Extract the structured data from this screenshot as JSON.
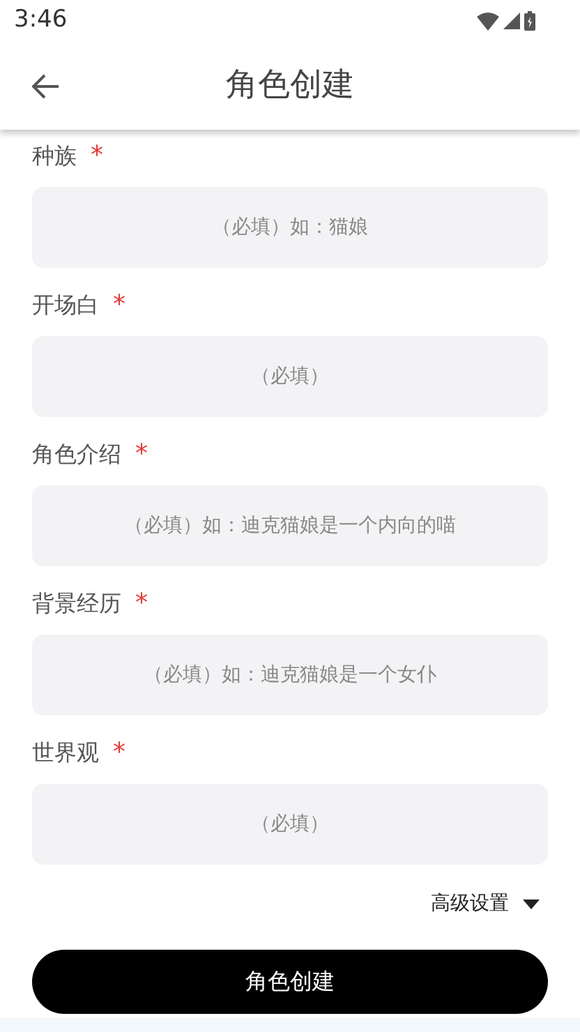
{
  "status_bar": {
    "time": "3:46"
  },
  "header": {
    "title": "角色创建"
  },
  "fields": [
    {
      "label": "种族",
      "required_mark": "*",
      "placeholder": "（必填）如：猫娘"
    },
    {
      "label": "开场白",
      "required_mark": "*",
      "placeholder": "（必填）"
    },
    {
      "label": "角色介绍",
      "required_mark": "*",
      "placeholder": "（必填）如：迪克猫娘是一个内向的喵"
    },
    {
      "label": "背景经历",
      "required_mark": "*",
      "placeholder": "（必填）如：迪克猫娘是一个女仆"
    },
    {
      "label": "世界观",
      "required_mark": "*",
      "placeholder": "（必填）"
    }
  ],
  "advanced": {
    "label": "高级设置",
    "expanded": false
  },
  "submit_button": "角色创建"
}
